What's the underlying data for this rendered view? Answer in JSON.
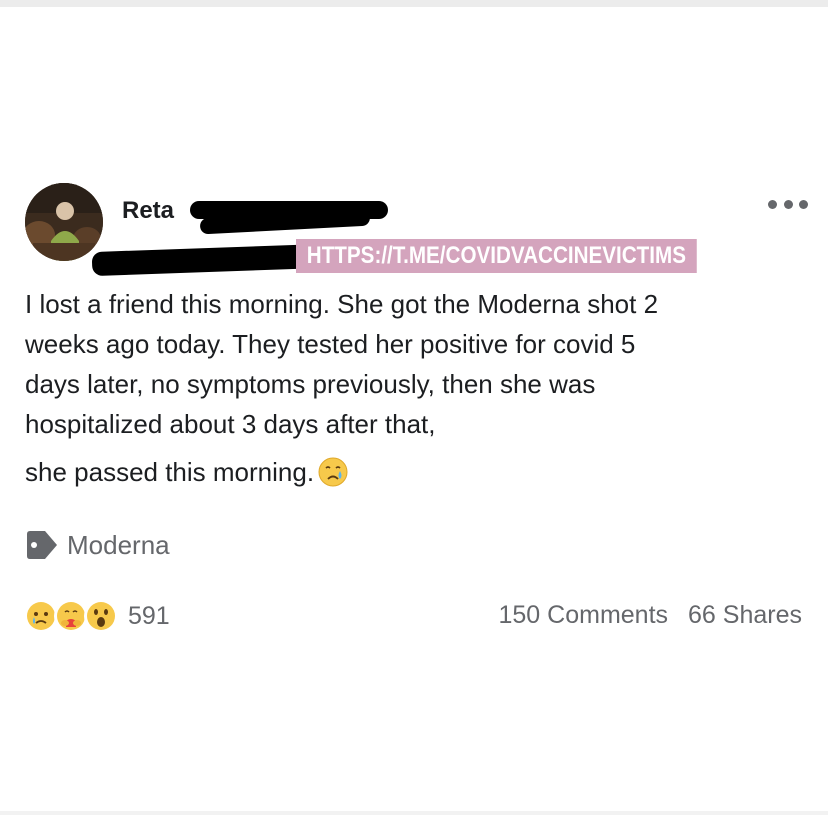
{
  "post": {
    "author": "Reta",
    "watermark": "HTTPS://T.ME/COVIDVACCINEVICTIMS",
    "body_lines": [
      "I lost a friend this morning.  She got the Moderna shot 2",
      "weeks ago today. They tested her positive for covid 5",
      "days later, no symptoms previously, then she was",
      "hospitalized about 3 days after that,"
    ],
    "body_last": "she passed this morning.",
    "tag": "Moderna",
    "reaction_count": "591",
    "comments": "150 Comments",
    "shares": "66 Shares"
  },
  "icons": {
    "more": "more-options-icon",
    "tag": "tag-icon",
    "reactions": [
      "sad-reaction-icon",
      "care-reaction-icon",
      "wow-reaction-icon"
    ],
    "inline_emoji": "crying-face-emoji"
  },
  "colors": {
    "text": "#1c1e21",
    "secondary": "#65676b",
    "watermark_bg": "#d4a4bd",
    "reaction_yellow": "#f7c94b"
  }
}
